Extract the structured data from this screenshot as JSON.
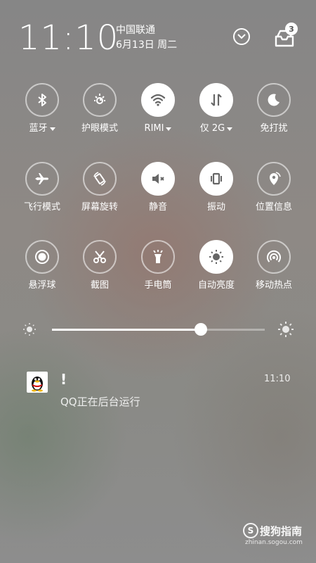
{
  "status": {
    "time": "11:10",
    "carrier": "中国联通",
    "date": "6月13日 周二",
    "inbox_badge": "3"
  },
  "tiles": [
    {
      "label": "蓝牙",
      "icon": "bluetooth-icon",
      "active": false,
      "dropdown": true
    },
    {
      "label": "护眼模式",
      "icon": "eye-care-icon",
      "active": false,
      "dropdown": false
    },
    {
      "label": "RIMI",
      "icon": "wifi-icon",
      "active": true,
      "dropdown": true
    },
    {
      "label": "仅 2G",
      "icon": "mobile-data-icon",
      "active": true,
      "dropdown": true
    },
    {
      "label": "免打扰",
      "icon": "moon-icon",
      "active": false,
      "dropdown": false
    },
    {
      "label": "飞行模式",
      "icon": "airplane-icon",
      "active": false,
      "dropdown": false
    },
    {
      "label": "屏幕旋转",
      "icon": "rotate-icon",
      "active": false,
      "dropdown": false
    },
    {
      "label": "静音",
      "icon": "mute-icon",
      "active": true,
      "dropdown": false
    },
    {
      "label": "振动",
      "icon": "vibrate-icon",
      "active": true,
      "dropdown": false
    },
    {
      "label": "位置信息",
      "icon": "location-icon",
      "active": false,
      "dropdown": false
    },
    {
      "label": "悬浮球",
      "icon": "floating-ball-icon",
      "active": false,
      "dropdown": false
    },
    {
      "label": "截图",
      "icon": "scissors-icon",
      "active": false,
      "dropdown": false
    },
    {
      "label": "手电筒",
      "icon": "flashlight-icon",
      "active": false,
      "dropdown": false
    },
    {
      "label": "自动亮度",
      "icon": "auto-brightness-icon",
      "active": true,
      "dropdown": false
    },
    {
      "label": "移动热点",
      "icon": "hotspot-icon",
      "active": false,
      "dropdown": false
    }
  ],
  "brightness": {
    "level": 0.7
  },
  "notification": {
    "title": "!",
    "time": "11:10",
    "text": "QQ正在后台运行",
    "app_icon": "qq-penguin-icon"
  },
  "watermark": {
    "name": "搜狗指南",
    "logo_letter": "S",
    "url": "zhinan.sogou.com"
  },
  "colors": {
    "icon_on": "#666666",
    "icon_off": "#ffffff"
  }
}
